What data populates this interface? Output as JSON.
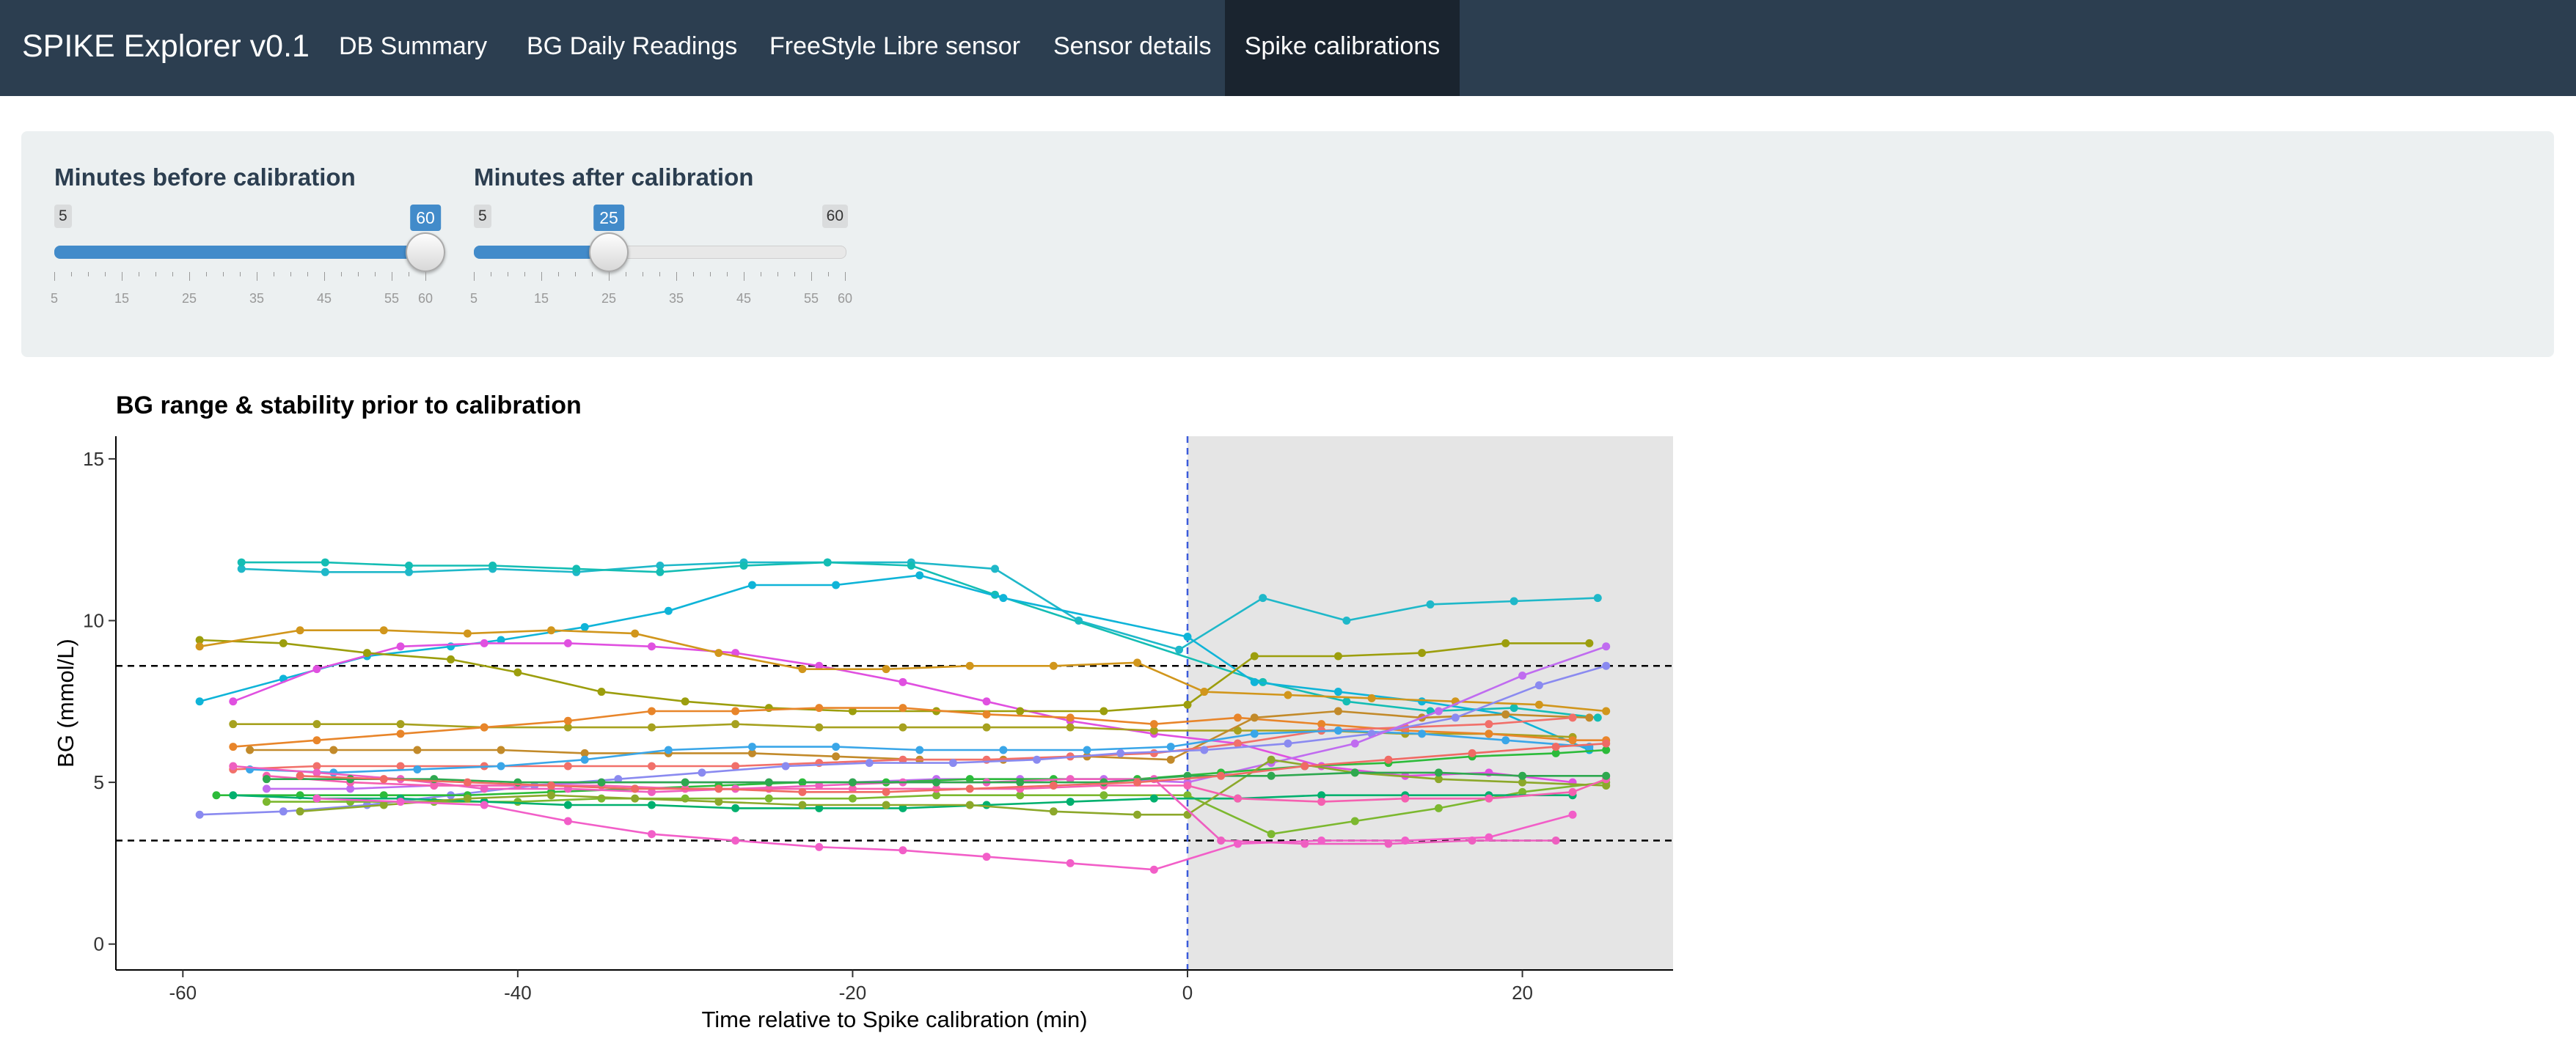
{
  "navbar": {
    "brand": "SPIKE Explorer v0.1",
    "tabs": [
      {
        "label": "DB Summary"
      },
      {
        "label": "BG Daily Readings"
      },
      {
        "label": "FreeStyle Libre sensor"
      },
      {
        "label": "Sensor details"
      },
      {
        "label": "Spike calibrations",
        "active": true
      }
    ],
    "colors": {
      "background": "#2c3e50",
      "active_tab": "#1a242f"
    }
  },
  "controls": {
    "before": {
      "label": "Minutes before calibration",
      "min": 5,
      "max": 60,
      "value": 60,
      "min_label": "5",
      "max_label": "60",
      "value_label": "60",
      "ticks": [
        "5",
        "15",
        "25",
        "35",
        "45",
        "55",
        "60"
      ]
    },
    "after": {
      "label": "Minutes after calibration",
      "min": 5,
      "max": 60,
      "value": 25,
      "min_label": "5",
      "max_label": "60",
      "value_label": "25",
      "ticks": [
        "5",
        "15",
        "25",
        "35",
        "45",
        "55",
        "60"
      ]
    },
    "accent_color": "#428bca"
  },
  "chart_data": {
    "type": "line",
    "title": "BG range & stability prior to calibration",
    "xlabel": "Time relative to Spike calibration (min)",
    "ylabel": "BG (mmol/L)",
    "xlim": [
      -64,
      29
    ],
    "ylim": [
      -0.8,
      15.7
    ],
    "xticks": [
      "-60",
      "-40",
      "-20",
      "0",
      "20"
    ],
    "yticks": [
      "0",
      "5",
      "10",
      "15"
    ],
    "grid": false,
    "shaded_region": {
      "from": 0,
      "to": 29,
      "color": "#e5e5e5"
    },
    "reference_lines": [
      {
        "orientation": "horizontal",
        "value": 8.6,
        "style": "dashed",
        "color": "#000000"
      },
      {
        "orientation": "horizontal",
        "value": 3.2,
        "style": "dashed",
        "color": "#000000"
      },
      {
        "orientation": "vertical",
        "value": 0,
        "style": "dashed",
        "color": "#3b5bdb"
      }
    ],
    "series": [
      {
        "color": "#1fb8c9",
        "x": [
          -56.5,
          -51.5,
          -46.5,
          -41.5,
          -36.5,
          -31.5,
          -26.5,
          -21.5,
          -16.5,
          -11.5,
          -6.5,
          -0.5,
          4.5,
          9.5,
          14.5,
          19.5,
          24.5
        ],
        "y": [
          11.6,
          11.5,
          11.5,
          11.6,
          11.5,
          11.7,
          11.8,
          11.8,
          11.8,
          11.6,
          10.0,
          9.1,
          10.7,
          10.0,
          10.5,
          10.6,
          10.7
        ]
      },
      {
        "color": "#14bdb4",
        "x": [
          -56.5,
          -51.5,
          -46.5,
          -41.5,
          -36.5,
          -31.5,
          -26.5,
          -21.5,
          -16.5,
          -11.5,
          4.5,
          9.5,
          14.5,
          19.5,
          24.5
        ],
        "y": [
          11.8,
          11.8,
          11.7,
          11.7,
          11.6,
          11.5,
          11.7,
          11.8,
          11.7,
          10.8,
          8.1,
          7.5,
          7.2,
          7.3,
          7.0
        ]
      },
      {
        "color": "#0fb4d8",
        "x": [
          -59,
          -54,
          -49,
          -44,
          -41,
          -36,
          -31,
          -26,
          -21,
          -16,
          -11,
          0,
          4,
          9,
          14,
          19,
          24
        ],
        "y": [
          7.5,
          8.2,
          8.9,
          9.2,
          9.4,
          9.8,
          10.3,
          11.1,
          11.1,
          11.4,
          10.7,
          9.5,
          8.1,
          7.8,
          7.5,
          7.1,
          6.0
        ]
      },
      {
        "color": "#e050e0",
        "x": [
          -57,
          -52,
          -47,
          -42,
          -37,
          -32,
          -27,
          -22,
          -17,
          -12,
          -7,
          -2,
          3,
          8,
          13,
          18,
          23
        ],
        "y": [
          7.5,
          8.5,
          9.2,
          9.3,
          9.3,
          9.2,
          9.0,
          8.6,
          8.1,
          7.5,
          6.9,
          6.5,
          6.2,
          5.5,
          5.2,
          5.3,
          5.0
        ]
      },
      {
        "color": "#9c9e0d",
        "x": [
          -59,
          -54,
          -49,
          -44,
          -40,
          -35,
          -30,
          -25,
          -20,
          -15,
          -10,
          -5,
          0,
          4,
          9,
          14,
          19,
          24
        ],
        "y": [
          9.4,
          9.3,
          9.0,
          8.8,
          8.4,
          7.8,
          7.5,
          7.3,
          7.2,
          7.2,
          7.2,
          7.2,
          7.4,
          8.9,
          8.9,
          9.0,
          9.3,
          9.3
        ]
      },
      {
        "color": "#d1961c",
        "x": [
          -59,
          -53,
          -48,
          -43,
          -38,
          -33,
          -28,
          -23,
          -18,
          -13,
          -8,
          -3,
          1,
          6,
          11,
          16,
          21,
          25
        ],
        "y": [
          9.2,
          9.7,
          9.7,
          9.6,
          9.7,
          9.6,
          9.0,
          8.5,
          8.5,
          8.6,
          8.6,
          8.7,
          7.8,
          7.7,
          7.6,
          7.5,
          7.4,
          7.2
        ]
      },
      {
        "color": "#a6a11f",
        "x": [
          -57,
          -52,
          -47,
          -42,
          -37,
          -32,
          -27,
          -22,
          -17,
          -12,
          -7,
          -2,
          3,
          8,
          13,
          18,
          23
        ],
        "y": [
          6.8,
          6.8,
          6.8,
          6.7,
          6.7,
          6.7,
          6.8,
          6.7,
          6.7,
          6.7,
          6.7,
          6.6,
          6.6,
          6.6,
          6.5,
          6.5,
          6.4
        ]
      },
      {
        "color": "#e8852a",
        "x": [
          -57,
          -52,
          -47,
          -42,
          -37,
          -32,
          -27,
          -22,
          -17,
          -12,
          -7,
          -2,
          3,
          8,
          13,
          18,
          23,
          25
        ],
        "y": [
          6.1,
          6.3,
          6.5,
          6.7,
          6.9,
          7.2,
          7.2,
          7.3,
          7.3,
          7.1,
          7.0,
          6.8,
          7.0,
          6.8,
          6.6,
          6.5,
          6.3,
          6.3
        ]
      },
      {
        "color": "#c28a2a",
        "x": [
          -56,
          -51,
          -46,
          -41,
          -36,
          -31,
          -26,
          -21,
          -16,
          -11,
          -6,
          -1,
          4,
          9,
          14,
          19,
          24
        ],
        "y": [
          6.0,
          6.0,
          6.0,
          6.0,
          5.9,
          5.9,
          5.9,
          5.8,
          5.7,
          5.7,
          5.8,
          5.7,
          7.0,
          7.2,
          7.0,
          7.1,
          7.0
        ]
      },
      {
        "color": "#f1706a",
        "x": [
          -57,
          -52,
          -47,
          -42,
          -37,
          -32,
          -27,
          -22,
          -17,
          -12,
          -7,
          -2,
          3,
          8,
          13,
          18,
          23
        ],
        "y": [
          5.4,
          5.5,
          5.5,
          5.5,
          5.5,
          5.5,
          5.5,
          5.6,
          5.7,
          5.7,
          5.8,
          5.9,
          6.2,
          6.6,
          6.7,
          6.8,
          7.0
        ]
      },
      {
        "color": "#3aa6e8",
        "x": [
          -56,
          -51,
          -46,
          -41,
          -36,
          -31,
          -26,
          -21,
          -16,
          -11,
          -6,
          -1,
          4,
          9,
          14,
          19,
          24
        ],
        "y": [
          5.4,
          5.3,
          5.4,
          5.5,
          5.7,
          6.0,
          6.1,
          6.1,
          6.0,
          6.0,
          6.0,
          6.1,
          6.5,
          6.6,
          6.5,
          6.3,
          6.1
        ]
      },
      {
        "color": "#8a8af0",
        "x": [
          -59,
          -54,
          -49,
          -44,
          -39,
          -34,
          -29,
          -24,
          -19,
          -14,
          -9,
          -4,
          1,
          6,
          11,
          16,
          21,
          25
        ],
        "y": [
          4.0,
          4.1,
          4.3,
          4.6,
          4.9,
          5.1,
          5.3,
          5.5,
          5.6,
          5.6,
          5.7,
          5.9,
          6.0,
          6.2,
          6.5,
          7.0,
          8.0,
          8.6
        ]
      },
      {
        "color": "#c06cf0",
        "x": [
          -55,
          -50,
          -45,
          -40,
          -35,
          -30,
          -25,
          -20,
          -15,
          -10,
          -5,
          0,
          5,
          10,
          15,
          20,
          25
        ],
        "y": [
          4.8,
          4.8,
          4.9,
          4.9,
          5.0,
          5.0,
          5.0,
          5.0,
          5.1,
          5.1,
          5.1,
          5.0,
          5.6,
          6.2,
          7.2,
          8.3,
          9.2
        ]
      },
      {
        "color": "#2cbb3a",
        "x": [
          -58,
          -53,
          -48,
          -43,
          -38,
          -33,
          -28,
          -23,
          -18,
          -13,
          -8,
          -3,
          2,
          7,
          12,
          17,
          22,
          25
        ],
        "y": [
          4.6,
          4.6,
          4.6,
          4.6,
          4.7,
          4.8,
          4.9,
          5.0,
          5.0,
          5.1,
          5.1,
          5.1,
          5.3,
          5.5,
          5.6,
          5.8,
          5.9,
          6.0
        ]
      },
      {
        "color": "#7cb82f",
        "x": [
          -55,
          -50,
          -45,
          -40,
          -35,
          -30,
          -25,
          -20,
          -15,
          -10,
          -5,
          0,
          5,
          10,
          15,
          20,
          25
        ],
        "y": [
          4.4,
          4.4,
          4.4,
          4.4,
          4.5,
          4.5,
          4.5,
          4.5,
          4.6,
          4.6,
          4.6,
          4.6,
          3.4,
          3.8,
          4.2,
          4.7,
          5.0
        ]
      },
      {
        "color": "#00b06e",
        "x": [
          -57,
          -52,
          -47,
          -42,
          -37,
          -32,
          -27,
          -22,
          -17,
          -12,
          -7,
          -2,
          3,
          8,
          13,
          18,
          23
        ],
        "y": [
          4.6,
          4.5,
          4.5,
          4.4,
          4.3,
          4.3,
          4.2,
          4.2,
          4.2,
          4.3,
          4.4,
          4.5,
          4.5,
          4.6,
          4.6,
          4.6,
          4.6
        ]
      },
      {
        "color": "#8ca82a",
        "x": [
          -53,
          -48,
          -43,
          -38,
          -33,
          -28,
          -23,
          -18,
          -13,
          -8,
          -3,
          0,
          5,
          10,
          15,
          20,
          25
        ],
        "y": [
          4.1,
          4.3,
          4.5,
          4.6,
          4.5,
          4.4,
          4.3,
          4.3,
          4.3,
          4.1,
          4.0,
          4.0,
          5.7,
          5.3,
          5.1,
          5.0,
          4.9
        ]
      },
      {
        "color": "#ee5fc0",
        "x": [
          -57,
          -52,
          -47,
          -42,
          -37,
          -32,
          -27,
          -22,
          -17,
          -12,
          -7,
          -2,
          2,
          7,
          12,
          17,
          22
        ],
        "y": [
          5.5,
          5.3,
          5.1,
          4.8,
          4.8,
          4.7,
          4.8,
          4.9,
          5.0,
          5.0,
          5.1,
          5.1,
          3.2,
          3.1,
          3.1,
          3.2,
          3.2
        ]
      },
      {
        "color": "#f25ec8",
        "x": [
          -52,
          -47,
          -42,
          -37,
          -32,
          -27,
          -22,
          -17,
          -12,
          -7,
          -2,
          3,
          8,
          13,
          18,
          23
        ],
        "y": [
          4.5,
          4.4,
          4.3,
          3.8,
          3.4,
          3.2,
          3.0,
          2.9,
          2.7,
          2.5,
          2.3,
          3.1,
          3.2,
          3.2,
          3.3,
          4.0
        ]
      },
      {
        "color": "#f560b0",
        "x": [
          -55,
          -50,
          -45,
          -40,
          -35,
          -30,
          -25,
          -20,
          -15,
          -10,
          -5,
          0,
          3,
          8,
          13,
          18,
          23,
          25
        ],
        "y": [
          5.2,
          5.0,
          4.9,
          4.9,
          4.9,
          4.8,
          4.8,
          4.8,
          4.8,
          4.8,
          4.9,
          4.9,
          4.5,
          4.4,
          4.5,
          4.5,
          4.7,
          5.1
        ]
      },
      {
        "color": "#2ea84f",
        "x": [
          -55,
          -50,
          -45,
          -40,
          -35,
          -30,
          -25,
          -20,
          -15,
          -10,
          -5,
          0,
          5,
          10,
          15,
          20,
          25
        ],
        "y": [
          5.1,
          5.1,
          5.1,
          5.0,
          5.0,
          5.0,
          5.0,
          5.0,
          5.0,
          5.0,
          5.0,
          5.2,
          5.2,
          5.3,
          5.3,
          5.2,
          5.2
        ]
      },
      {
        "color": "#f06a64",
        "x": [
          -53,
          -48,
          -43,
          -38,
          -33,
          -28,
          -23,
          -18,
          -13,
          -8,
          -3,
          2,
          7,
          12,
          17,
          22,
          25
        ],
        "y": [
          5.2,
          5.1,
          5.0,
          4.9,
          4.8,
          4.8,
          4.7,
          4.7,
          4.8,
          4.9,
          5.0,
          5.2,
          5.5,
          5.7,
          5.9,
          6.1,
          6.2
        ]
      }
    ]
  }
}
